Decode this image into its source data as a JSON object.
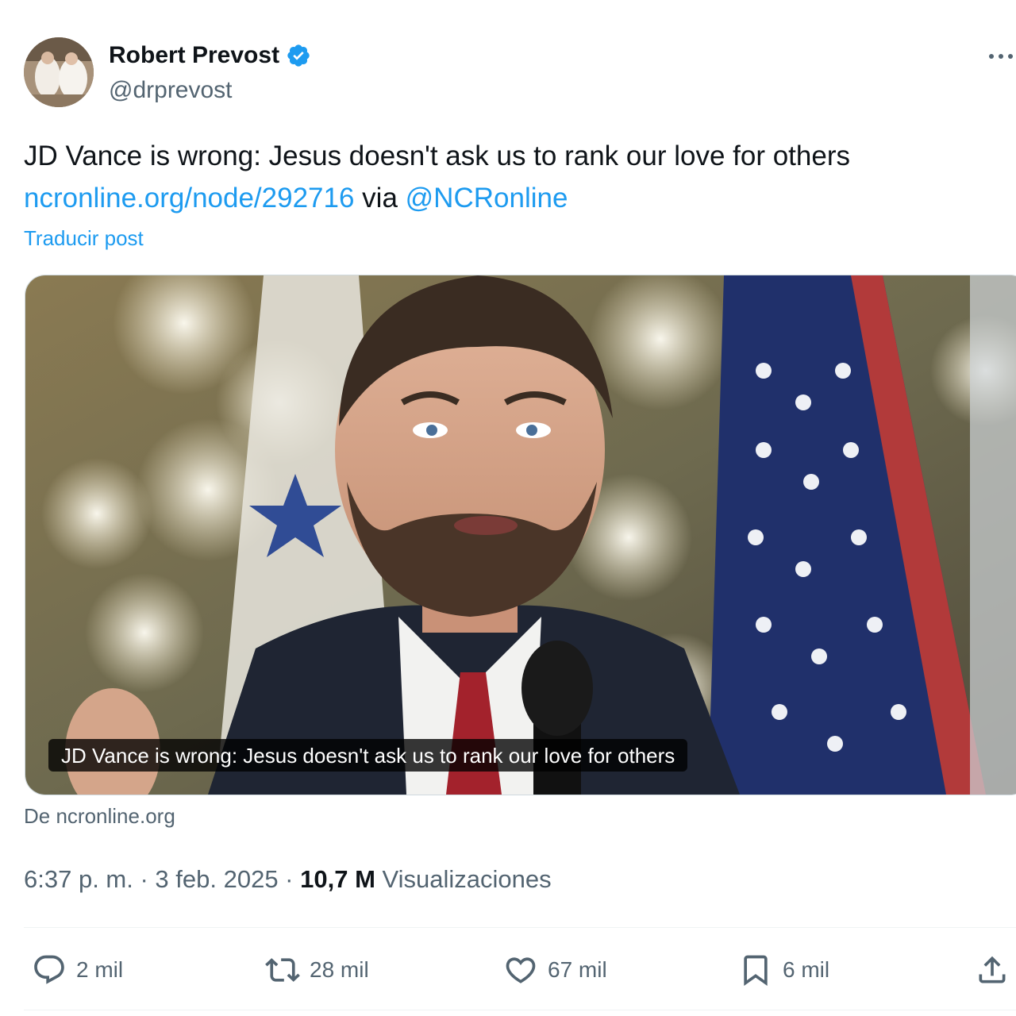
{
  "author": {
    "display_name": "Robert Prevost",
    "handle": "@drprevost",
    "verified": true,
    "avatar_icon": "profile-photo"
  },
  "tweet": {
    "text_main": "JD Vance is wrong: Jesus doesn't ask us to rank our love for others",
    "link_text": "ncronline.org/node/292716",
    "via_text": " via ",
    "mention_text": "@NCRonline",
    "translate_label": "Traducir post"
  },
  "card": {
    "caption": "JD Vance is wrong: Jesus doesn't ask us to rank our love for others",
    "source": "De ncronline.org"
  },
  "meta": {
    "time": "6:37 p. m.",
    "separator": " · ",
    "date": "3 feb. 2025",
    "views_count": "10,7 M",
    "views_label": " Visualizaciones"
  },
  "actions": {
    "replies": "2 mil",
    "reposts": "28 mil",
    "likes": "67 mil",
    "bookmarks": "6 mil"
  },
  "colors": {
    "link": "#1d9bf0",
    "secondary_text": "#536471",
    "primary_text": "#0f1419",
    "divider": "#eff3f4",
    "verified": "#1d9bf0"
  }
}
